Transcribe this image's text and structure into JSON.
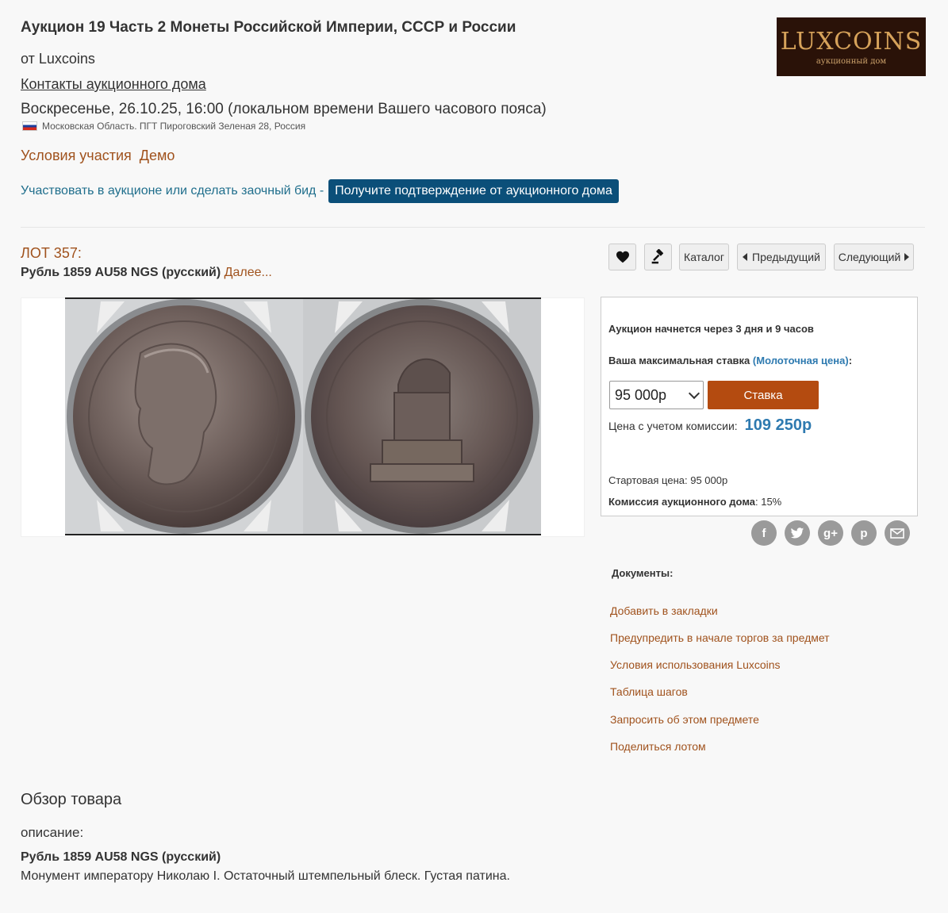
{
  "header": {
    "title": "Аукцион 19 Часть 2 Монеты Российской Империи, СССР и России",
    "by": "от Luxcoins",
    "contacts": "Контакты аукционного дома",
    "datetime": "Воскресенье, 26.10.25, 16:00 (локальном времени Вашего часового пояса)",
    "location": "Московская Область. ПГТ Пироговский Зеленая 28, Россия",
    "terms": "Условия участия",
    "demo": "Демо",
    "participate": "Участвовать в аукционе или сделать заочный бид -",
    "confirm_button": "Получите подтверждение от аукционного дома"
  },
  "logo": {
    "main": "LUXCOINS",
    "sub": "аукционный дом"
  },
  "lot": {
    "number": "ЛОТ 357:",
    "title": "Рубль 1859 AU58 NGS (русский)",
    "more": "Далее..."
  },
  "toolbar": {
    "catalog": "Каталог",
    "prev": "Предыдущий",
    "next": "Следующий"
  },
  "bid": {
    "starts_in": "Аукцион начнется через 3 дня и 9 часов",
    "max_bid_label": "Ваша максимальная ставка",
    "hammer_price": "(Молоточная цена)",
    "colon": ":",
    "selected_amount": "95 000р",
    "bid_button": "Ставка",
    "price_with_commission_label": "Цена с учетом комиссии:",
    "price_with_commission": "109 250р",
    "start_price": "Стартовая цена: 95 000р",
    "commission_label": "Комиссия аукционного дома",
    "commission_value": ": 15%"
  },
  "social": {
    "facebook": "f",
    "twitter": "t",
    "googleplus": "g+",
    "pinterest": "p"
  },
  "documents": {
    "title": "Документы:",
    "links": [
      "Добавить в закладки",
      "Предупредить в начале торгов за предмет",
      "Условия использования Luxcoins",
      "Таблица шагов",
      "Запросить об этом предмете",
      "Поделиться лотом"
    ]
  },
  "overview": {
    "title": "Обзор товара",
    "desc_label": "описание:",
    "desc_title": "Рубль 1859 AU58 NGS (русский)",
    "desc_text": "Монумент императору Николаю I. Остаточный штемпельный блеск. Густая патина."
  },
  "colors": {
    "accent": "#a0521d",
    "link_blue": "#2e7ab0",
    "button_dark": "#0b4f79",
    "bid_button": "#b44b10"
  }
}
